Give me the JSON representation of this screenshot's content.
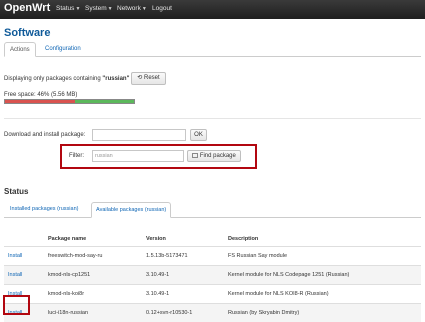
{
  "nav": {
    "brand": "OpenWrt",
    "items": [
      {
        "label": "Status"
      },
      {
        "label": "System"
      },
      {
        "label": "Network"
      },
      {
        "label": "Logout"
      }
    ]
  },
  "page": {
    "title": "Software",
    "tabs": [
      {
        "label": "Actions"
      },
      {
        "label": "Configuration"
      }
    ]
  },
  "filter_notice": {
    "prefix": "Displaying only packages containing",
    "term": "\"russian\"",
    "reset_label": "Reset"
  },
  "free_space": {
    "label": "Free space: 46% (5.56 MB)",
    "percent_used": 54
  },
  "download": {
    "label": "Download and install package:",
    "value": "",
    "ok_label": "OK"
  },
  "filter": {
    "label": "Filter:",
    "placeholder": "russian",
    "button_label": "Find package"
  },
  "status": {
    "heading": "Status",
    "tabs": [
      {
        "label": "Installed packages (russian)"
      },
      {
        "label": "Available packages (russian)"
      }
    ]
  },
  "table": {
    "headers": [
      "",
      "Package name",
      "Version",
      "Description"
    ],
    "rows": [
      {
        "action": "Install",
        "name": "freeswitch-mod-say-ru",
        "version": "1.5.13b-5173471",
        "description": "FS Russian Say module"
      },
      {
        "action": "Install",
        "name": "kmod-nls-cp1251",
        "version": "3.10.49-1",
        "description": "Kernel module for NLS Codepage 1251 (Russian)"
      },
      {
        "action": "Install",
        "name": "kmod-nls-koi8r",
        "version": "3.10.49-1",
        "description": "Kernel module for NLS KOI8-R (Russian)"
      },
      {
        "action": "Install",
        "name": "luci-i18n-russian",
        "version": "0.12+svn-r10530-1",
        "description": "Russian (by Skryabin Dmitry)"
      }
    ]
  },
  "colors": {
    "nav_bg": "#2b2b2b",
    "title": "#0f5a99",
    "link": "#0f66b5",
    "highlight": "#b20710",
    "used": "#d9534f",
    "free": "#5cb85c"
  }
}
